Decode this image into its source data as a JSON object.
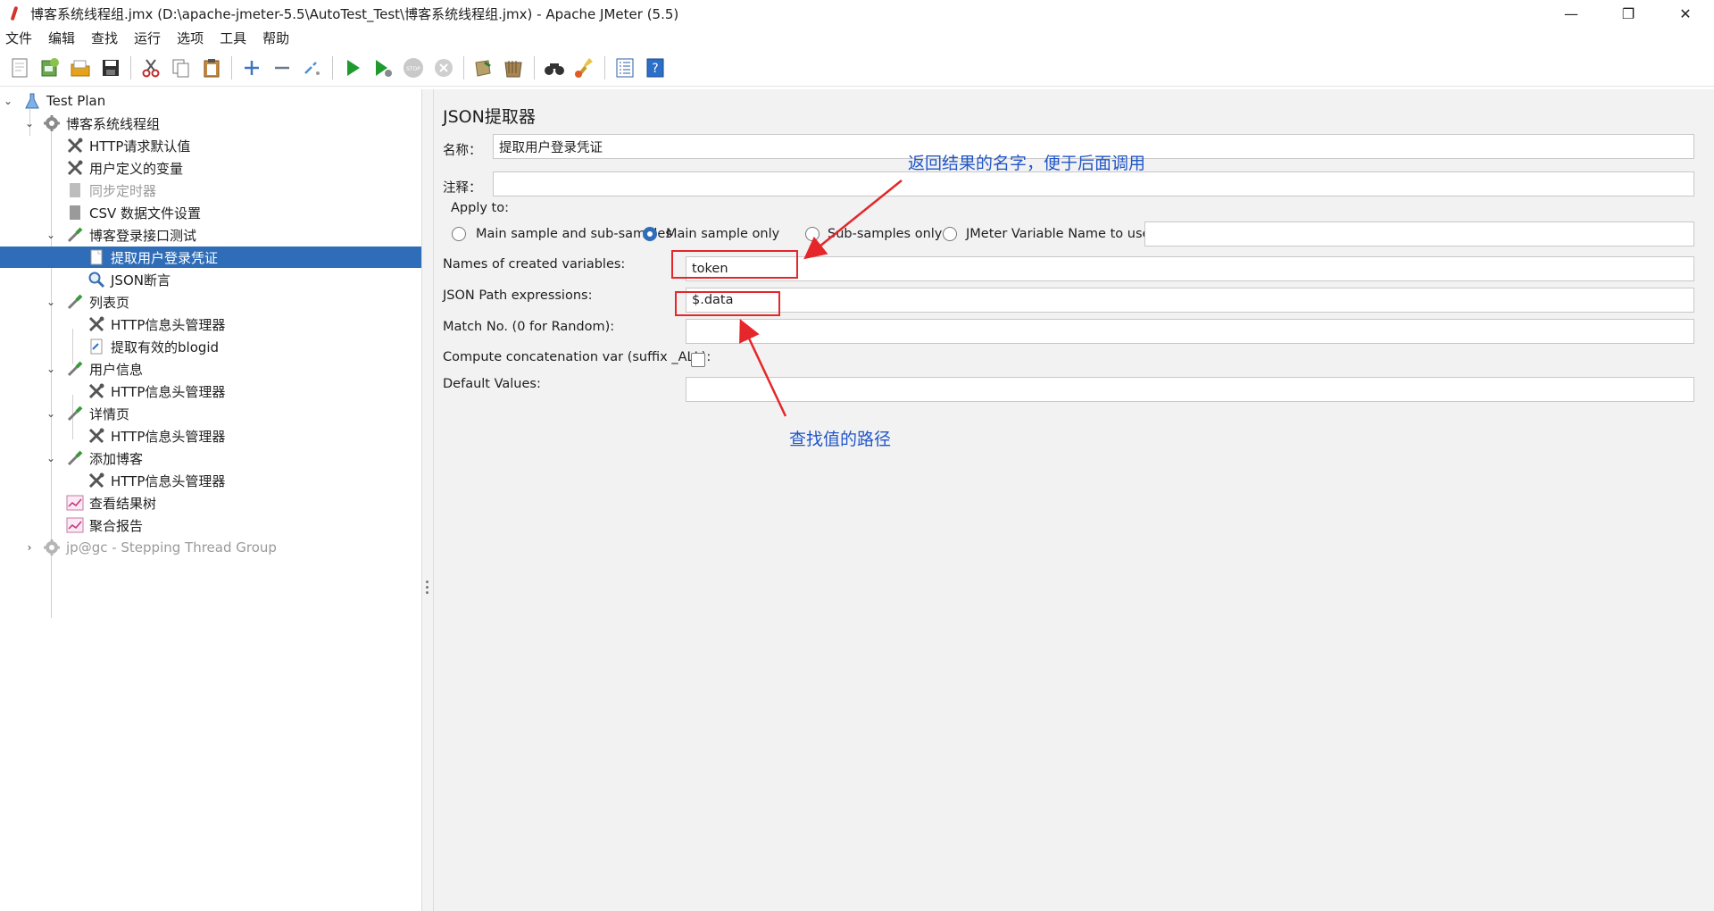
{
  "window": {
    "title": "博客系统线程组.jmx (D:\\apache-jmeter-5.5\\AutoTest_Test\\博客系统线程组.jmx) - Apache JMeter (5.5)",
    "controls": [
      "—",
      "❐",
      "✕"
    ]
  },
  "menu": [
    "文件",
    "编辑",
    "查找",
    "运行",
    "选项",
    "工具",
    "帮助"
  ],
  "toolbar_icons": [
    "new-icon",
    "templates-icon",
    "open-icon",
    "save-icon",
    "cut-icon",
    "copy-icon",
    "paste-icon",
    "expand-icon",
    "collapse-icon",
    "toggle-icon",
    "start-icon",
    "start-no-pause-icon",
    "stop-icon",
    "shutdown-icon",
    "clear-icon",
    "clear-all-icon",
    "search-icon",
    "reset-search-icon",
    "function-helper-icon",
    "help-icon"
  ],
  "tree": [
    {
      "label": "Test Plan"
    },
    {
      "label": "博客系统线程组"
    },
    {
      "label": "HTTP请求默认值"
    },
    {
      "label": "用户定义的变量"
    },
    {
      "label": "同步定时器"
    },
    {
      "label": "CSV 数据文件设置"
    },
    {
      "label": "博客登录接口测试"
    },
    {
      "label": "提取用户登录凭证"
    },
    {
      "label": "JSON断言"
    },
    {
      "label": "列表页"
    },
    {
      "label": "HTTP信息头管理器"
    },
    {
      "label": "提取有效的blogid"
    },
    {
      "label": "用户信息"
    },
    {
      "label": "HTTP信息头管理器"
    },
    {
      "label": "详情页"
    },
    {
      "label": "HTTP信息头管理器"
    },
    {
      "label": "添加博客"
    },
    {
      "label": "HTTP信息头管理器"
    },
    {
      "label": "查看结果树"
    },
    {
      "label": "聚合报告"
    },
    {
      "label": "jp@gc - Stepping Thread Group"
    }
  ],
  "form": {
    "title": "JSON提取器",
    "name_label": "名称：",
    "name_value": "提取用户登录凭证",
    "comment_label": "注释：",
    "comment_value": "",
    "apply_to_label": "Apply to:",
    "apply_options": [
      "Main sample and sub-samples",
      "Main sample only",
      "Sub-samples only",
      "JMeter Variable Name to use"
    ],
    "apply_selected": "Main sample only",
    "jmeter_var_value": "",
    "var_names_label": "Names of created variables:",
    "var_names_value": "token",
    "json_path_label": "JSON Path expressions:",
    "json_path_value": "$.data",
    "match_no_label": "Match No. (0 for Random):",
    "match_no_value": "",
    "concat_label": "Compute concatenation var (suffix _ALL):",
    "concat_checked": false,
    "default_label": "Default Values:",
    "default_value": ""
  },
  "annotations": {
    "top_note": "返回结果的名字，便于后面调用",
    "bottom_note": "查找值的路径",
    "color": "#2156c9",
    "box_color": "#e5262a"
  },
  "colors": {
    "selection": "#2f6db8",
    "panel_bg": "#f2f2f2"
  }
}
